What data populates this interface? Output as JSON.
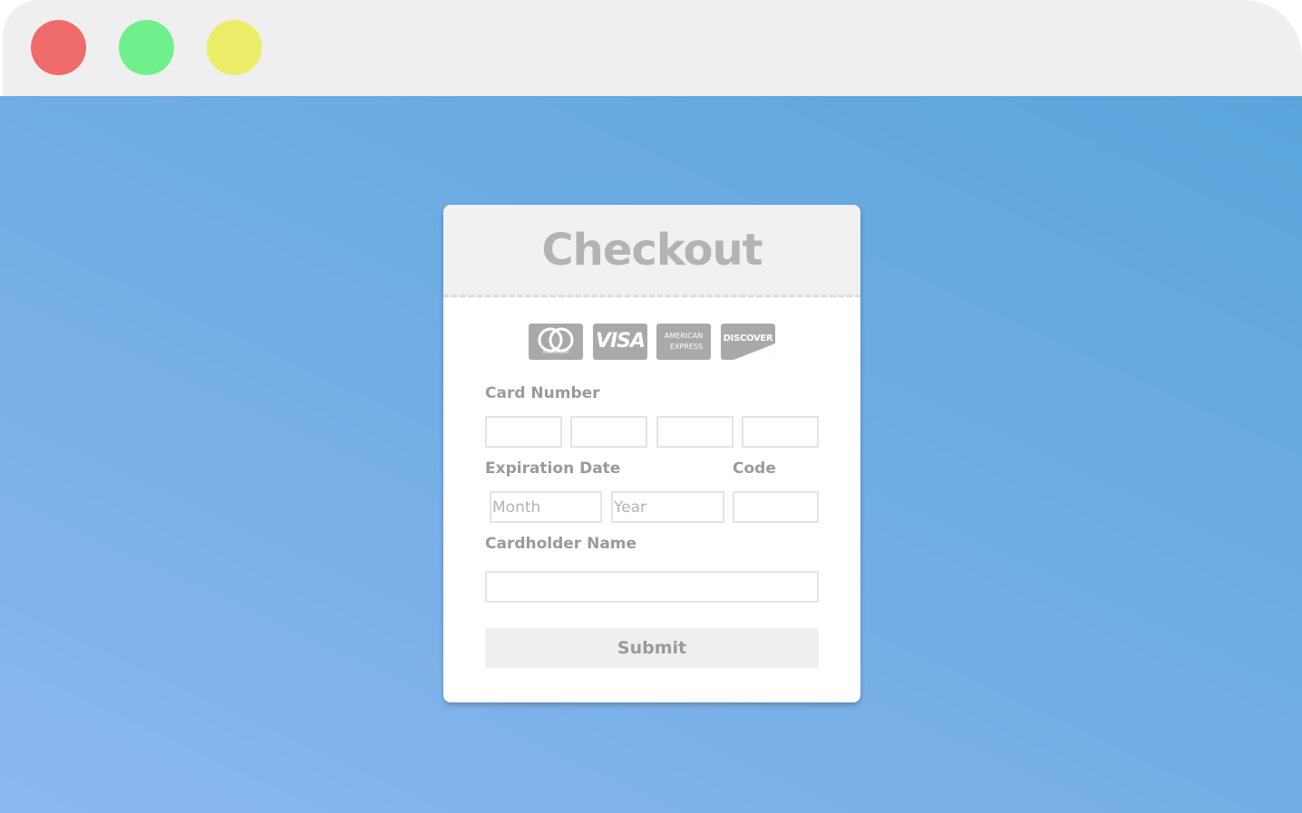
{
  "window": {
    "buttons": [
      {
        "name": "close",
        "color": "#f06b6b"
      },
      {
        "name": "maximize",
        "color": "#6ff08d"
      },
      {
        "name": "minimize",
        "color": "#ecec69"
      }
    ]
  },
  "checkout": {
    "title": "Checkout",
    "card_logos": [
      {
        "name": "mastercard-icon",
        "text": "mastercard"
      },
      {
        "name": "visa-icon",
        "text": "VISA"
      },
      {
        "name": "amex-icon",
        "text_line1": "AMERICAN",
        "text_line2": "EXPRESS"
      },
      {
        "name": "discover-icon",
        "text": "DISCOVER"
      }
    ],
    "card_number": {
      "label": "Card Number",
      "fields": [
        "",
        "",
        "",
        ""
      ]
    },
    "expiration": {
      "label": "Expiration Date",
      "month_placeholder": "Month",
      "year_placeholder": "Year"
    },
    "code": {
      "label": "Code",
      "value": ""
    },
    "cardholder": {
      "label": "Cardholder Name",
      "value": ""
    },
    "submit_label": "Submit"
  },
  "colors": {
    "background_gradient_start": "#8ab8ee",
    "background_gradient_end": "#5aa6dc",
    "label_text": "#9a9a9a",
    "logo_gray": "#a9a9a9"
  }
}
